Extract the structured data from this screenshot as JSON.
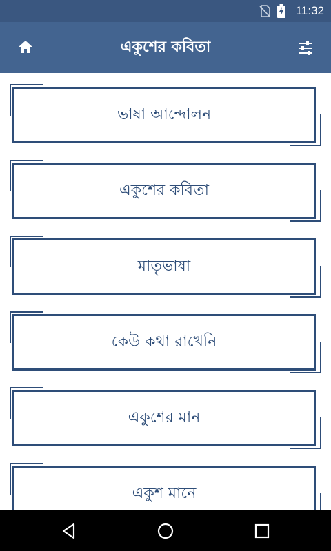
{
  "status_bar": {
    "time": "11:32",
    "icons": [
      "no-sim-icon",
      "battery-charging-icon"
    ]
  },
  "app_bar": {
    "title": "একুশের কবিতা",
    "left_icon": "home-icon",
    "right_icon": "settings-sliders-icon"
  },
  "menu": {
    "items": [
      {
        "label": "ভাষা আন্দোলন"
      },
      {
        "label": "একুশের কবিতা"
      },
      {
        "label": "মাতৃভাষা"
      },
      {
        "label": "কেউ কথা রাখেনি"
      },
      {
        "label": "একুশের মান"
      },
      {
        "label": "একুশ মানে"
      }
    ]
  },
  "nav_bar": {
    "icons": [
      "back-icon",
      "home-circle-icon",
      "recents-icon"
    ]
  },
  "colors": {
    "app_bar": "#436490",
    "status_bar": "#3a5780",
    "card_border": "#2e4d78",
    "card_text": "#2e4d78"
  }
}
